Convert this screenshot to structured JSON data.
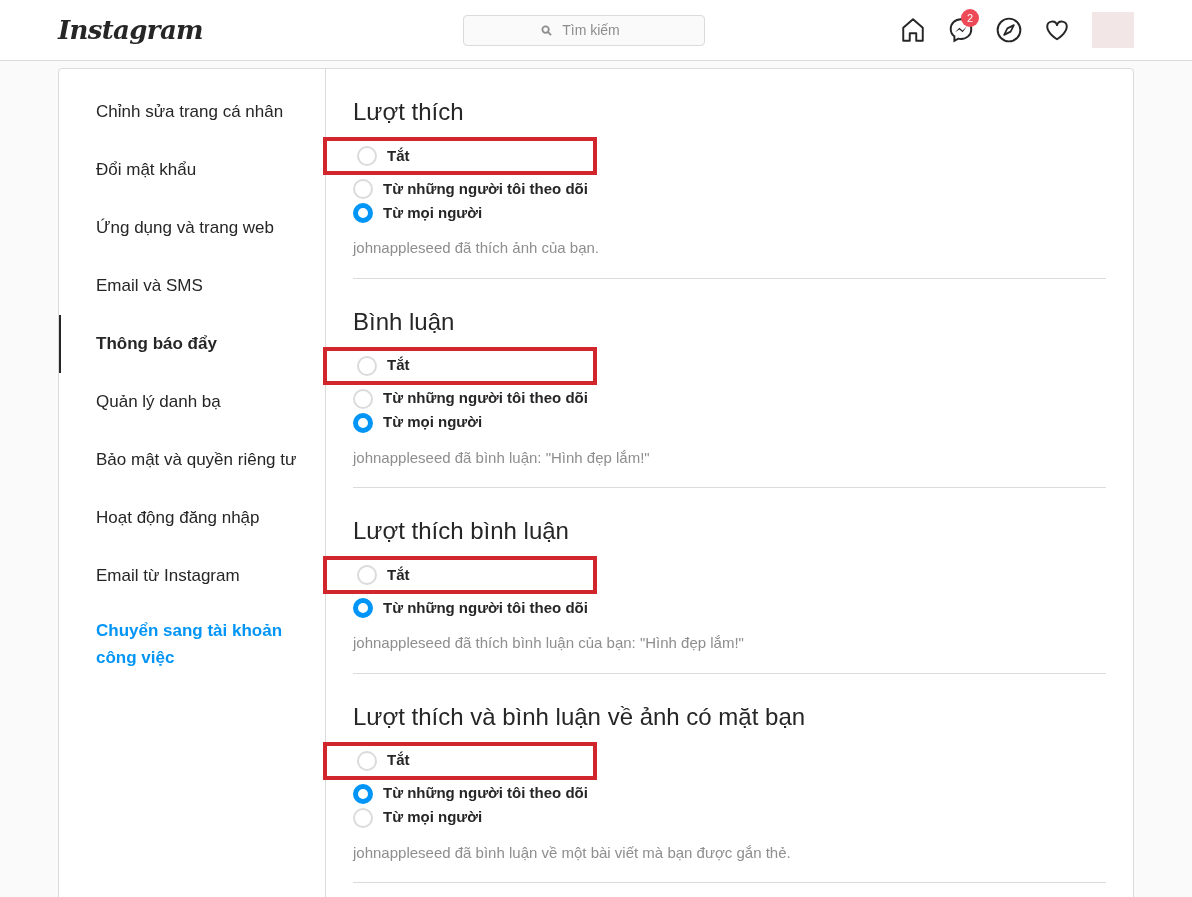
{
  "header": {
    "logo": "Instagram",
    "search": {
      "placeholder": "Tìm kiếm"
    },
    "messages_badge": "2"
  },
  "sidebar": {
    "items": [
      {
        "label": "Chỉnh sửa trang cá nhân",
        "selected": false
      },
      {
        "label": "Đổi mật khẩu",
        "selected": false
      },
      {
        "label": "Ứng dụng và trang web",
        "selected": false
      },
      {
        "label": "Email và SMS",
        "selected": false
      },
      {
        "label": "Thông báo đẩy",
        "selected": true
      },
      {
        "label": "Quản lý danh bạ",
        "selected": false
      },
      {
        "label": "Bảo mật và quyền riêng tư",
        "selected": false
      },
      {
        "label": "Hoạt động đăng nhập",
        "selected": false
      },
      {
        "label": "Email từ Instagram",
        "selected": false
      }
    ],
    "switch_link": "Chuyển sang tài khoản công việc"
  },
  "sections": [
    {
      "title": "Lượt thích",
      "options": [
        {
          "label": "Tắt",
          "selected": false,
          "highlighted": true
        },
        {
          "label": "Từ những người tôi theo dõi",
          "selected": false,
          "highlighted": false
        },
        {
          "label": "Từ mọi người",
          "selected": true,
          "highlighted": false
        }
      ],
      "example": "johnappleseed đã thích ảnh của bạn."
    },
    {
      "title": "Bình luận",
      "options": [
        {
          "label": "Tắt",
          "selected": false,
          "highlighted": true
        },
        {
          "label": "Từ những người tôi theo dõi",
          "selected": false,
          "highlighted": false
        },
        {
          "label": "Từ mọi người",
          "selected": true,
          "highlighted": false
        }
      ],
      "example": "johnappleseed đã bình luận: \"Hình đẹp lắm!\""
    },
    {
      "title": "Lượt thích bình luận",
      "options": [
        {
          "label": "Tắt",
          "selected": false,
          "highlighted": true
        },
        {
          "label": "Từ những người tôi theo dõi",
          "selected": true,
          "highlighted": false
        }
      ],
      "example": "johnappleseed đã thích bình luận của bạn: \"Hình đẹp lắm!\""
    },
    {
      "title": "Lượt thích và bình luận về ảnh có mặt bạn",
      "options": [
        {
          "label": "Tắt",
          "selected": false,
          "highlighted": true
        },
        {
          "label": "Từ những người tôi theo dõi",
          "selected": true,
          "highlighted": false
        },
        {
          "label": "Từ mọi người",
          "selected": false,
          "highlighted": false
        }
      ],
      "example": "johnappleseed đã bình luận về một bài viết mà bạn được gắn thẻ."
    }
  ]
}
